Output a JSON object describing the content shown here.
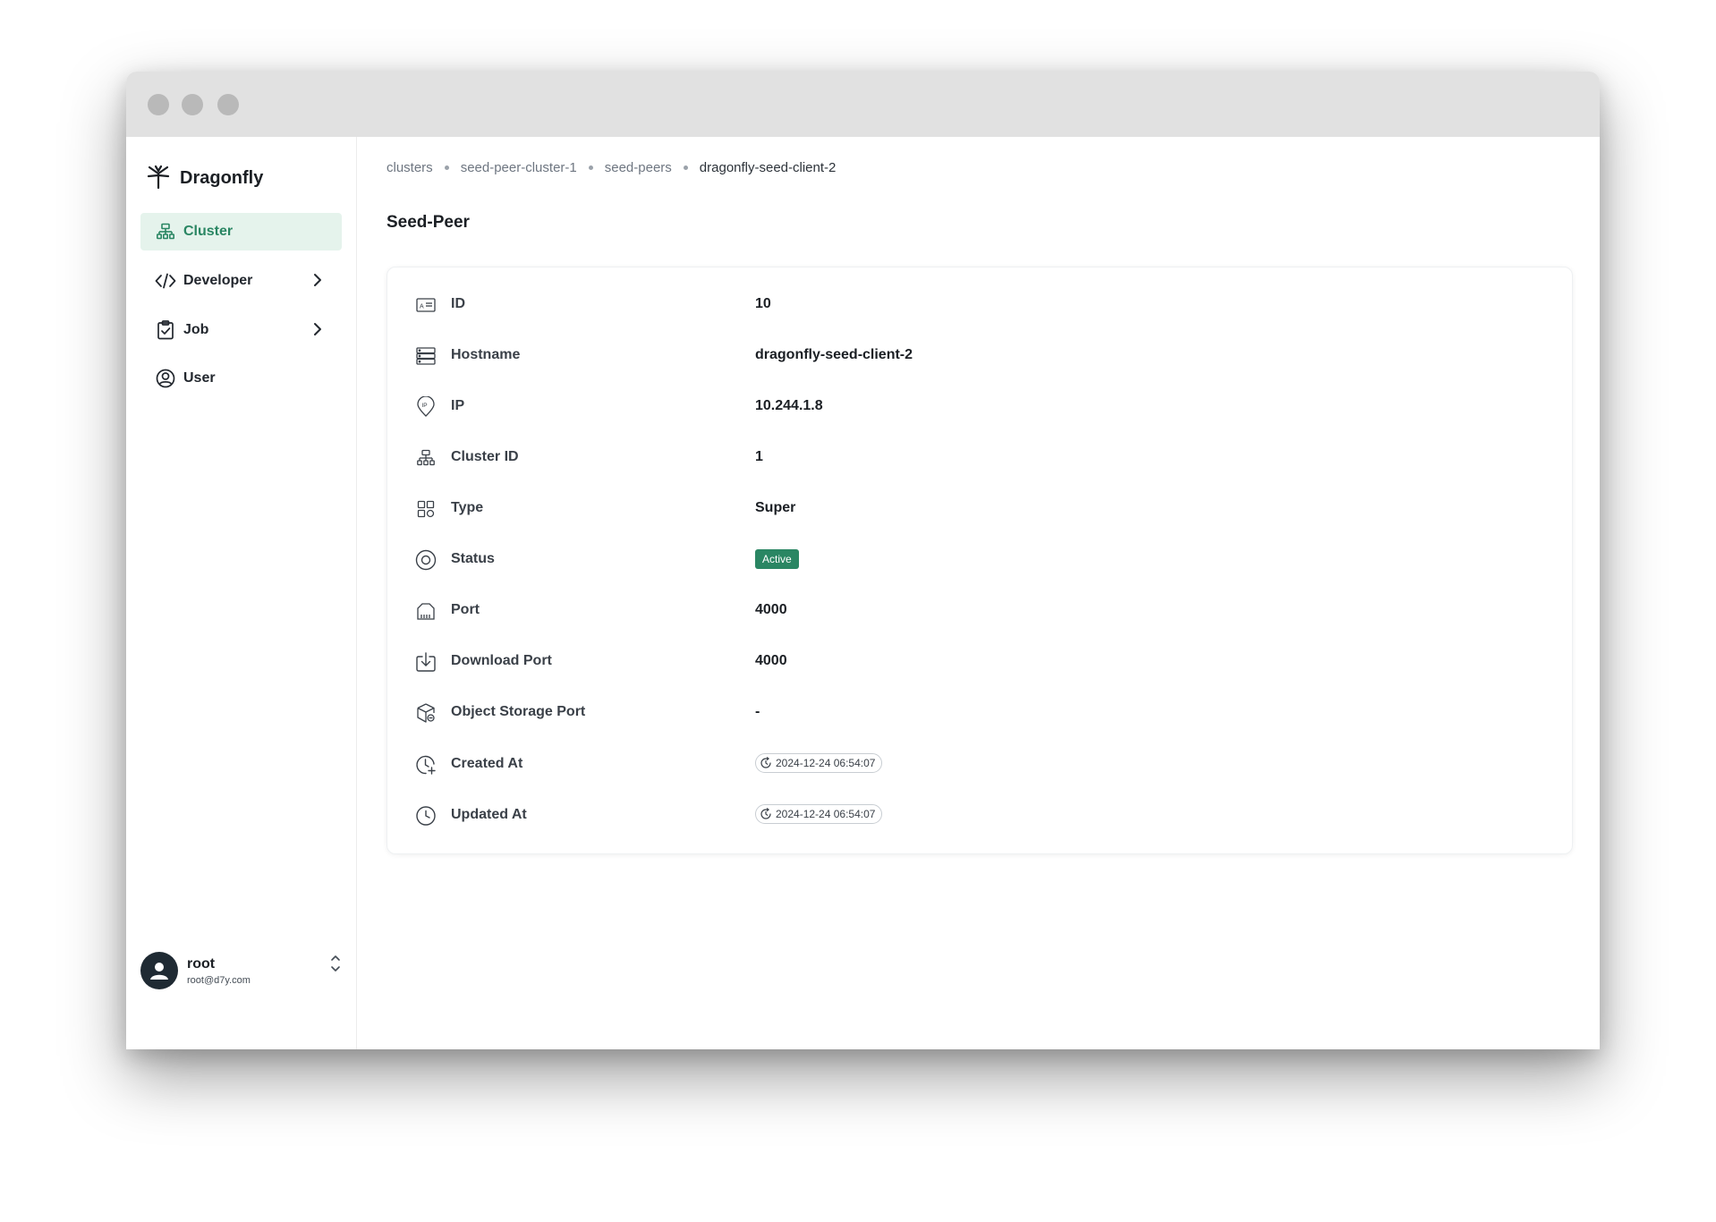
{
  "app": {
    "brand": "Dragonfly"
  },
  "sidebar": {
    "items": [
      {
        "label": "Cluster",
        "icon": "cluster-icon",
        "active": true
      },
      {
        "label": "Developer",
        "icon": "code-icon",
        "has_submenu": true
      },
      {
        "label": "Job",
        "icon": "job-icon",
        "has_submenu": true
      },
      {
        "label": "User",
        "icon": "user-icon"
      }
    ],
    "user": {
      "name": "root",
      "email": "root@d7y.com"
    }
  },
  "breadcrumb": [
    "clusters",
    "seed-peer-cluster-1",
    "seed-peers",
    "dragonfly-seed-client-2"
  ],
  "page": {
    "title": "Seed-Peer"
  },
  "details": {
    "id": {
      "label": "ID",
      "value": "10"
    },
    "hostname": {
      "label": "Hostname",
      "value": "dragonfly-seed-client-2"
    },
    "ip": {
      "label": "IP",
      "value": "10.244.1.8"
    },
    "cluster_id": {
      "label": "Cluster ID",
      "value": "1"
    },
    "type": {
      "label": "Type",
      "value": "Super"
    },
    "status": {
      "label": "Status",
      "value": "Active"
    },
    "port": {
      "label": "Port",
      "value": "4000"
    },
    "download_port": {
      "label": "Download Port",
      "value": "4000"
    },
    "object_storage_port": {
      "label": "Object Storage Port",
      "value": "-"
    },
    "created_at": {
      "label": "Created At",
      "value": "2024-12-24 06:54:07"
    },
    "updated_at": {
      "label": "Updated At",
      "value": "2024-12-24 06:54:07"
    }
  },
  "colors": {
    "accent": "#2a8663",
    "accent_bg": "#e5f3ec"
  }
}
